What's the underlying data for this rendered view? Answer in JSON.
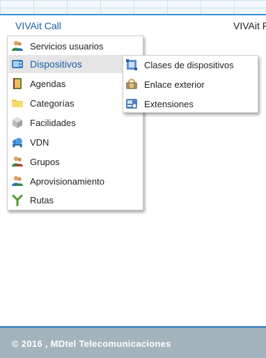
{
  "header": {
    "brand": "VIVAit Call",
    "brand_right": "VIVAit R"
  },
  "main_menu": {
    "items": [
      {
        "label": "Servicios usuarios",
        "icon": "users-icon"
      },
      {
        "label": "Dispositivos",
        "icon": "device-icon",
        "active": true
      },
      {
        "label": "Agendas",
        "icon": "agenda-book-icon"
      },
      {
        "label": "Categorías",
        "icon": "folder-icon"
      },
      {
        "label": "Facilidades",
        "icon": "box-icon"
      },
      {
        "label": "VDN",
        "icon": "cloud-network-icon"
      },
      {
        "label": "Grupos",
        "icon": "group-icon"
      },
      {
        "label": "Aprovisionamiento",
        "icon": "provisioning-icon"
      },
      {
        "label": "Rutas",
        "icon": "route-icon"
      }
    ]
  },
  "sub_menu": {
    "items": [
      {
        "label": "Clases de dispositivos",
        "icon": "device-classes-icon"
      },
      {
        "label": "Enlace exterior",
        "icon": "external-link-icon"
      },
      {
        "label": "Extensiones",
        "icon": "extensions-icon"
      }
    ]
  },
  "footer": {
    "text": "© 2016 , MDtel Telecomunicaciones"
  },
  "colors": {
    "accent": "#1a5fa8",
    "footer_bg": "#a4b4bd",
    "footer_border": "#4f8cc0"
  }
}
